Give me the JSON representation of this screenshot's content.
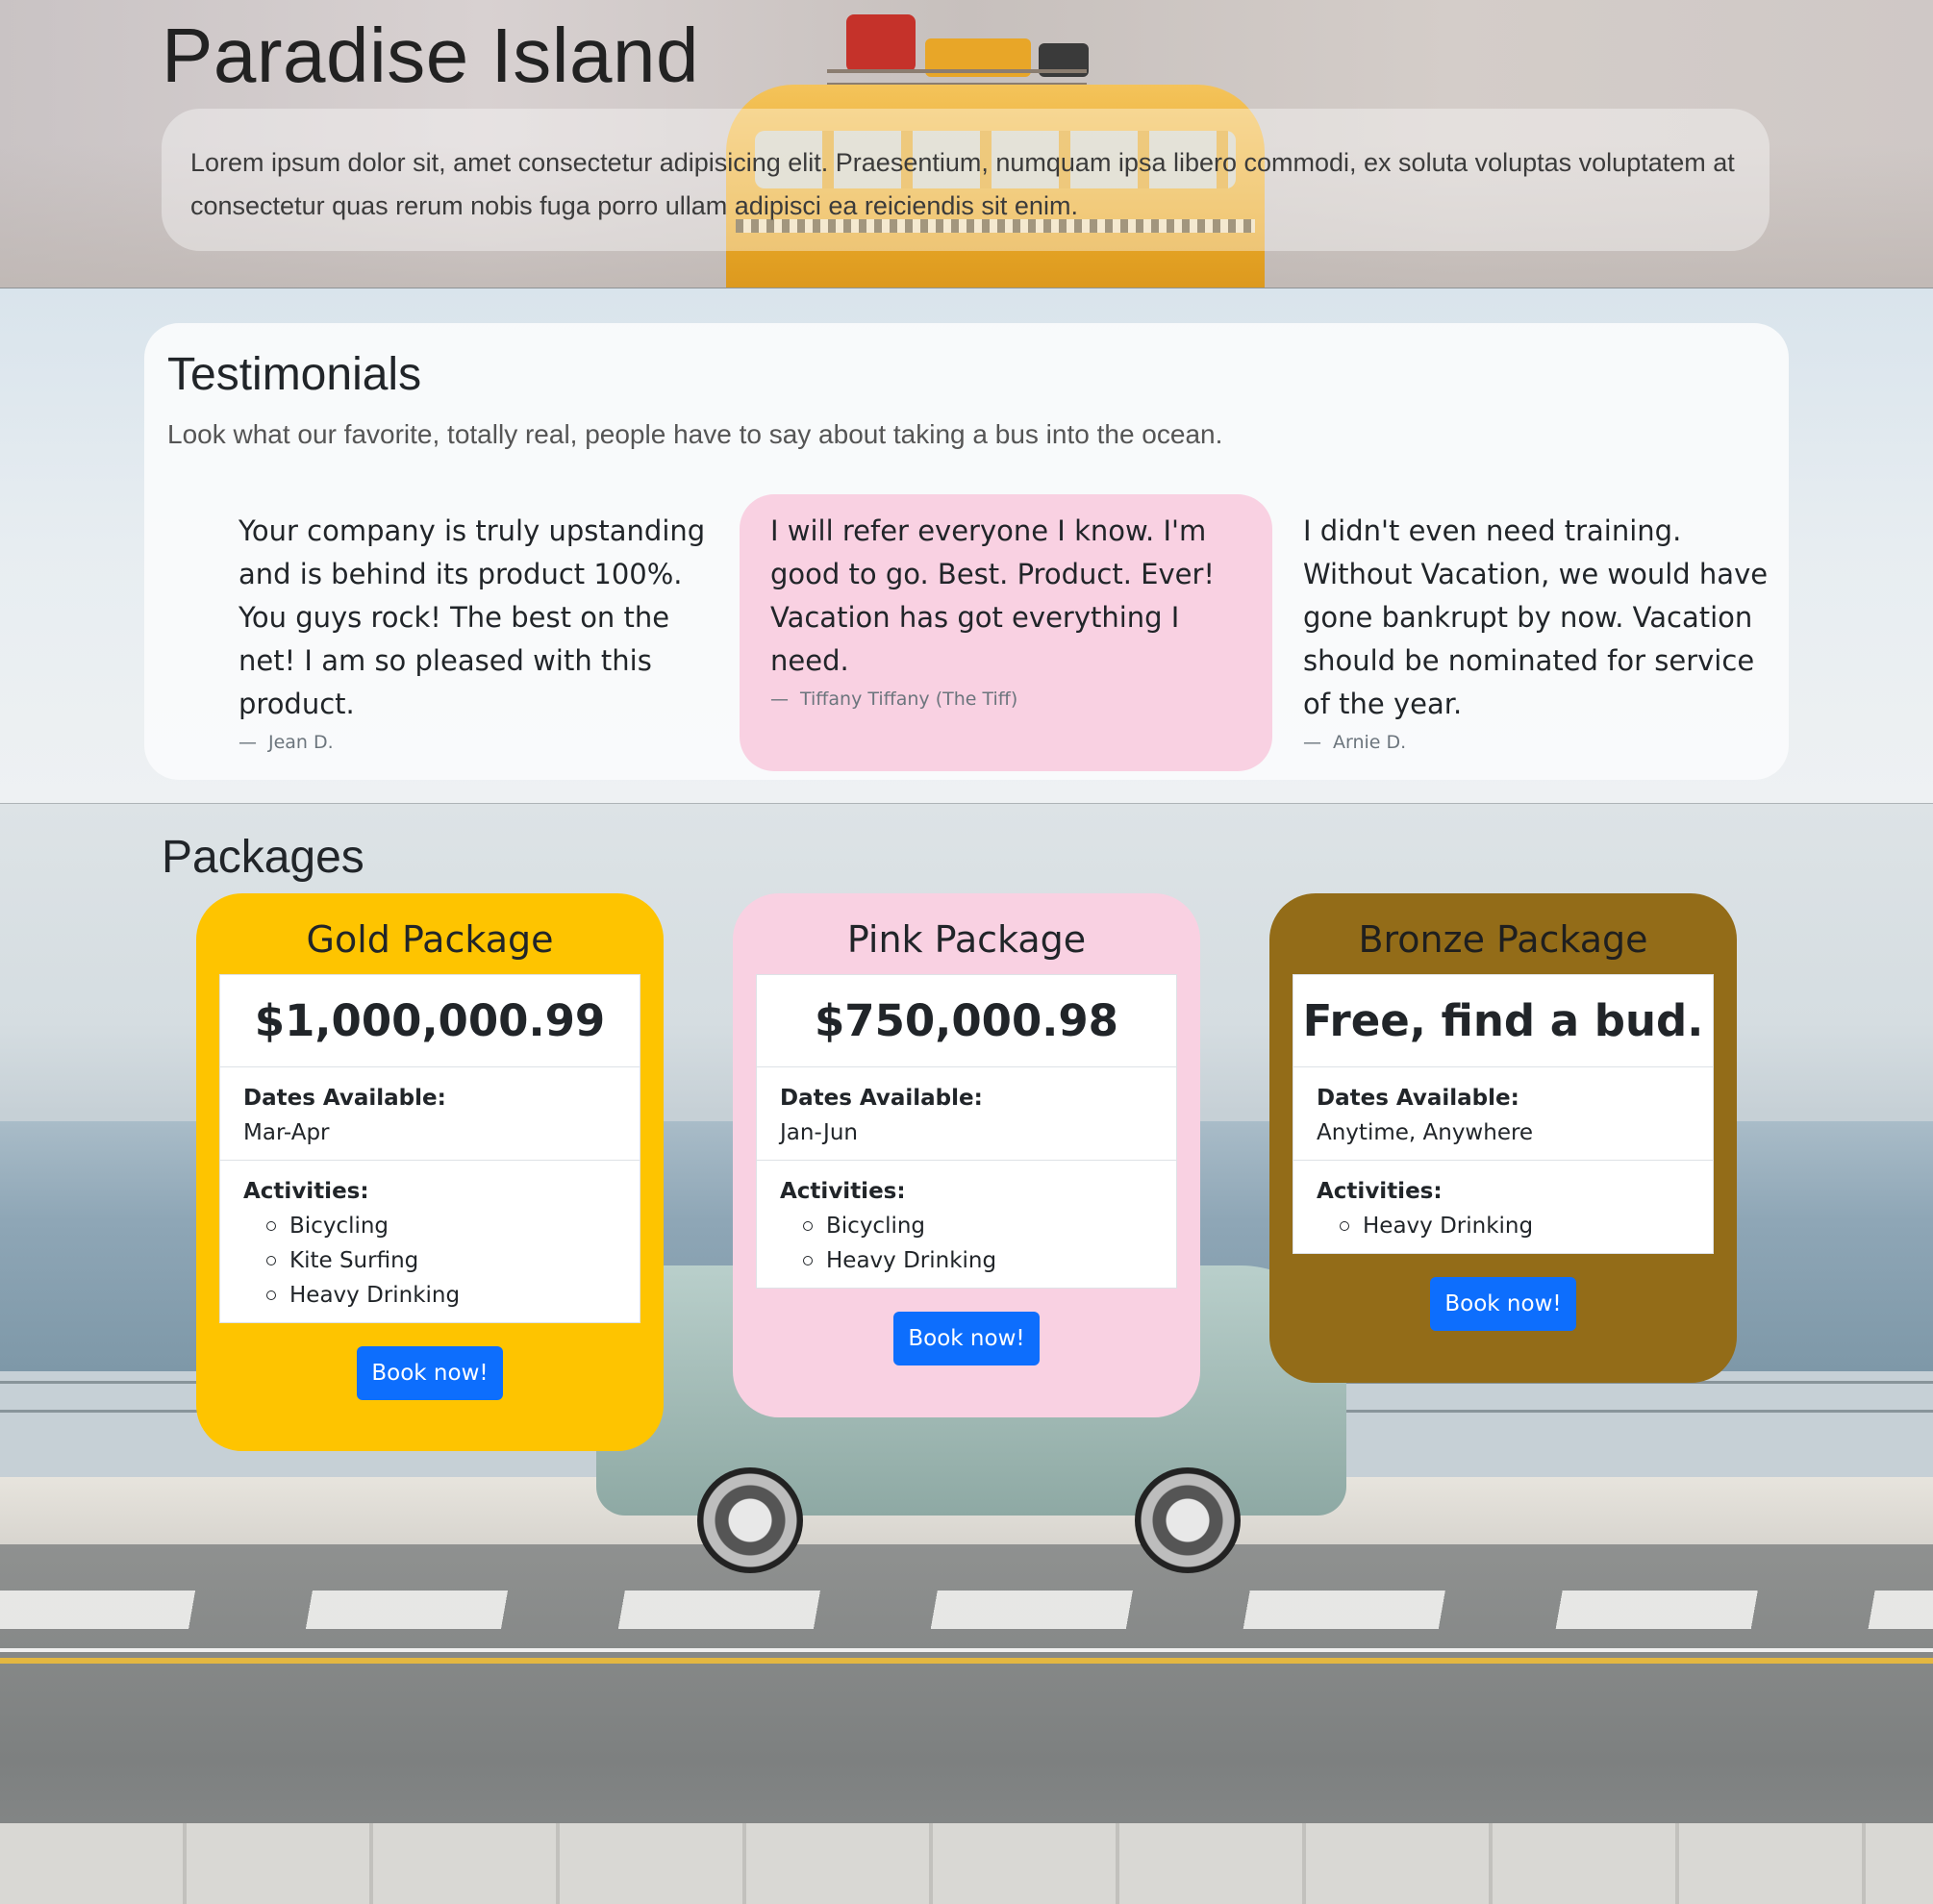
{
  "hero": {
    "title": "Paradise Island",
    "lead": "Lorem ipsum dolor sit, amet consectetur adipisicing elit. Praesentium, numquam ipsa libero commodi, ex soluta voluptas voluptatem at consectetur quas rerum nobis fuga porro ullam adipisci ea reiciendis sit enim."
  },
  "testimonials": {
    "title": "Testimonials",
    "subtitle": "Look what our favorite, totally real, people have to say about taking a bus into the ocean.",
    "quotes": [
      {
        "text": "Your company is truly upstanding and is behind its product 100%. You guys rock! The best on the net! I am so pleased with this product.",
        "author": "Jean D."
      },
      {
        "text": "I will refer everyone I know. I'm good to go. Best. Product. Ever! Vacation has got everything I need.",
        "author": "Tiffany Tiffany (The Tiff)"
      },
      {
        "text": "I didn't even need training. Without Vacation, we would have gone bankrupt by now. Vacation should be nominated for service of the year.",
        "author": "Arnie D."
      }
    ],
    "dash": "—"
  },
  "packages": {
    "title": "Packages",
    "dates_label": "Dates Available:",
    "activities_label": "Activities:",
    "book_label": "Book now!",
    "items": [
      {
        "name": "Gold Package",
        "price": "$1,000,000.99",
        "dates": "Mar-Apr",
        "activities": [
          "Bicycling",
          "Kite Surfing",
          "Heavy Drinking"
        ],
        "color": "#fec400"
      },
      {
        "name": "Pink Package",
        "price": "$750,000.98",
        "dates": "Jan-Jun",
        "activities": [
          "Bicycling",
          "Heavy Drinking"
        ],
        "color": "#f9d1e2"
      },
      {
        "name": "Bronze Package",
        "price": "Free, find a bud.",
        "dates": "Anytime, Anywhere",
        "activities": [
          "Heavy Drinking"
        ],
        "color": "#936c18"
      }
    ]
  },
  "colors": {
    "button": "#0d6efd",
    "highlight_quote": "#f9d1e2"
  }
}
